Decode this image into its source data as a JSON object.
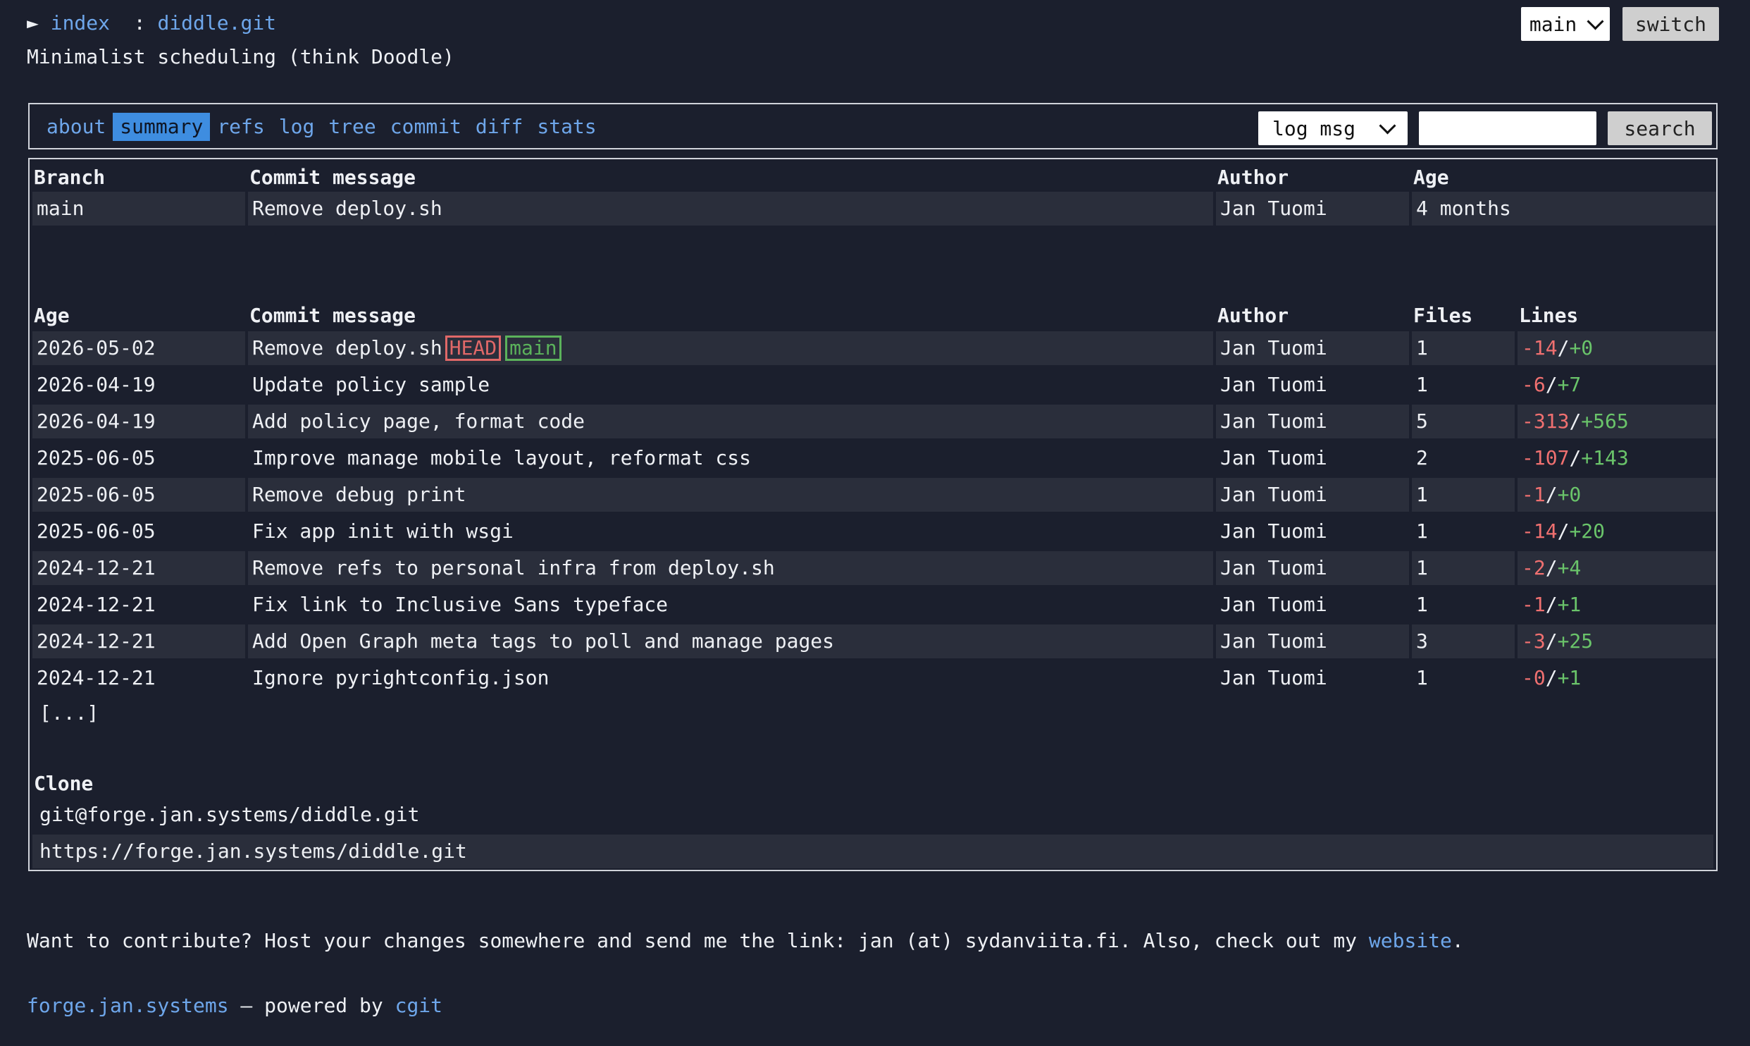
{
  "header": {
    "arrow": "►",
    "index_link": "index",
    "separator": ":",
    "repo_link": "diddle.git",
    "description": "Minimalist scheduling (think Doodle)",
    "branch_selected": "main",
    "switch_label": "switch"
  },
  "tabs": {
    "items": [
      "about",
      "summary",
      "refs",
      "log",
      "tree",
      "commit",
      "diff",
      "stats"
    ],
    "active": "summary",
    "search_mode": "log msg",
    "search_value": "",
    "search_label": "search"
  },
  "branches": {
    "headers": {
      "branch": "Branch",
      "message": "Commit message",
      "author": "Author",
      "age": "Age"
    },
    "rows": [
      {
        "branch": "main",
        "message": "Remove deploy.sh",
        "author": "Jan Tuomi",
        "age": "4 months"
      }
    ]
  },
  "commits": {
    "headers": {
      "age": "Age",
      "message": "Commit message",
      "author": "Author",
      "files": "Files",
      "lines": "Lines"
    },
    "head_tag": "HEAD",
    "branch_tag": "main",
    "rows": [
      {
        "age": "2026-05-02",
        "message": "Remove deploy.sh",
        "author": "Jan Tuomi",
        "files": "1",
        "del": "-14",
        "add": "+0"
      },
      {
        "age": "2026-04-19",
        "message": "Update policy sample",
        "author": "Jan Tuomi",
        "files": "1",
        "del": "-6",
        "add": "+7"
      },
      {
        "age": "2026-04-19",
        "message": "Add policy page, format code",
        "author": "Jan Tuomi",
        "files": "5",
        "del": "-313",
        "add": "+565"
      },
      {
        "age": "2025-06-05",
        "message": "Improve manage mobile layout, reformat css",
        "author": "Jan Tuomi",
        "files": "2",
        "del": "-107",
        "add": "+143"
      },
      {
        "age": "2025-06-05",
        "message": "Remove debug print",
        "author": "Jan Tuomi",
        "files": "1",
        "del": "-1",
        "add": "+0"
      },
      {
        "age": "2025-06-05",
        "message": "Fix app init with wsgi",
        "author": "Jan Tuomi",
        "files": "1",
        "del": "-14",
        "add": "+20"
      },
      {
        "age": "2024-12-21",
        "message": "Remove refs to personal infra from deploy.sh",
        "author": "Jan Tuomi",
        "files": "1",
        "del": "-2",
        "add": "+4"
      },
      {
        "age": "2024-12-21",
        "message": "Fix link to Inclusive Sans typeface",
        "author": "Jan Tuomi",
        "files": "1",
        "del": "-1",
        "add": "+1"
      },
      {
        "age": "2024-12-21",
        "message": "Add Open Graph meta tags to poll and manage pages",
        "author": "Jan Tuomi",
        "files": "3",
        "del": "-3",
        "add": "+25"
      },
      {
        "age": "2024-12-21",
        "message": "Ignore pyrightconfig.json",
        "author": "Jan Tuomi",
        "files": "1",
        "del": "-0",
        "add": "+1"
      }
    ],
    "more": "[...]"
  },
  "clone": {
    "header": "Clone",
    "urls": [
      "git@forge.jan.systems/diddle.git",
      "https://forge.jan.systems/diddle.git"
    ]
  },
  "footer": {
    "contribute_text": "Want to contribute? Host your changes somewhere and send me the link: jan (at) sydanviita.fi. Also, check out my ",
    "website_link": "website",
    "contribute_end": ".",
    "site_link": "forge.jan.systems",
    "powered_text": " — powered by ",
    "cgit_link": "cgit"
  },
  "colors": {
    "background": "#1b1f2d",
    "link": "#6ea6ea",
    "active_tab": "#3e8de0",
    "deletions": "#f07070",
    "additions": "#6ac46a"
  }
}
